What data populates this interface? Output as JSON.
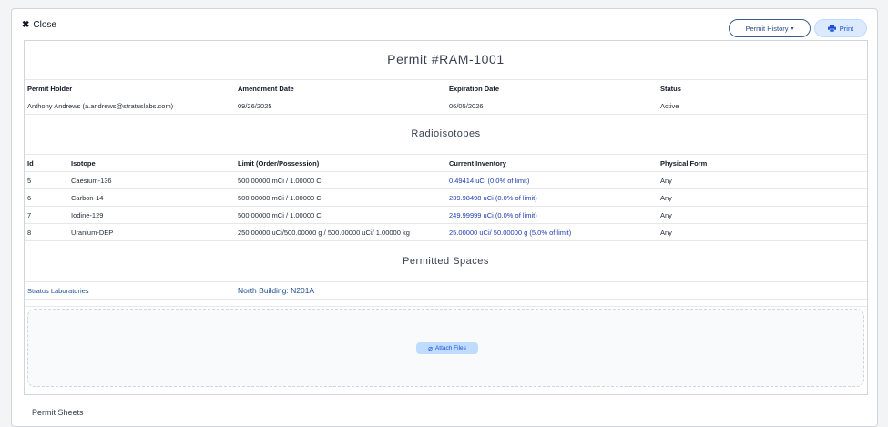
{
  "header": {
    "close_label": "Close",
    "permit_history_label": "Permit History",
    "print_label": "Print"
  },
  "permit": {
    "title": "Permit #RAM-1001",
    "columns": [
      "Permit Holder",
      "Amendment Date",
      "Expiration Date",
      "Status"
    ],
    "holder": "Anthony Andrews (a.andrews@stratuslabs.com)",
    "amendment_date": "09/26/2025",
    "expiration_date": "06/05/2026",
    "status": "Active"
  },
  "radioisotopes": {
    "title": "Radioisotopes",
    "columns": [
      "Id",
      "Isotope",
      "Limit (Order/Possession)",
      "Current Inventory",
      "Physical Form"
    ],
    "rows": [
      {
        "id": "5",
        "isotope": "Caesium-136",
        "limit": "500.00000 mCi / 1.00000 Ci",
        "inventory": "0.49414 uCi (0.0% of limit)",
        "form": "Any"
      },
      {
        "id": "6",
        "isotope": "Carbon-14",
        "limit": "500.00000 mCi / 1.00000 Ci",
        "inventory": "239.98498 uCi (0.0% of limit)",
        "form": "Any"
      },
      {
        "id": "7",
        "isotope": "Iodine-129",
        "limit": "500.00000 mCi / 1.00000 Ci",
        "inventory": "249.99999 uCi (0.0% of limit)",
        "form": "Any"
      },
      {
        "id": "8",
        "isotope": "Uranium-DEP",
        "limit": "250.00000 uCi/500.00000 g / 500.00000 uCi/ 1.00000 kg",
        "inventory": "25.00000 uCi/ 50.00000 g (5.0% of limit)",
        "form": "Any"
      }
    ]
  },
  "spaces": {
    "title": "Permitted Spaces",
    "organization": "Stratus Laboratories",
    "room": "North Building: N201A"
  },
  "attachments": {
    "attach_label": "Attach Files"
  },
  "footer": {
    "next_section_label": "Permit Sheets"
  }
}
